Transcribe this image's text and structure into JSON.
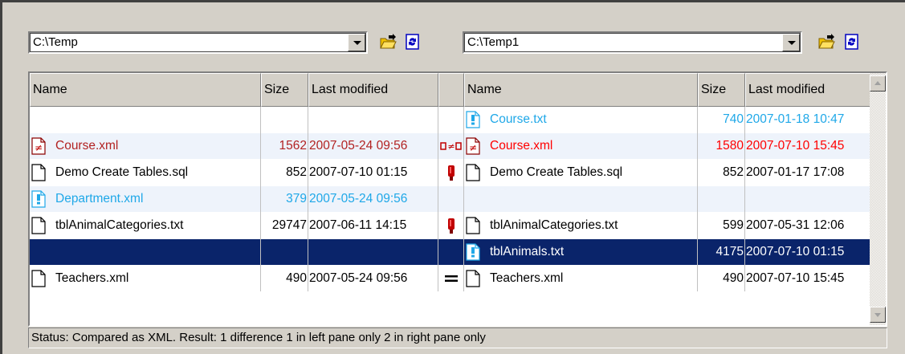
{
  "left_path": "C:\\Temp",
  "right_path": "C:\\Temp1",
  "columns": {
    "name": "Name",
    "size": "Size",
    "modified": "Last modified"
  },
  "colors": {
    "red": "#b22222",
    "brightred": "#ff0000",
    "blue": "#1fa8e8",
    "selected_bg": "#0a246a"
  },
  "rows": [
    {
      "left": null,
      "compare": null,
      "right": {
        "name": "Course.txt",
        "size": "740",
        "modified": "2007-01-18 10:47",
        "icon": "file-only-icon",
        "color": "blue"
      },
      "style": "plain"
    },
    {
      "left": {
        "name": "Course.xml",
        "size": "1562",
        "modified": "2007-05-24 09:56",
        "icon": "file-different-icon",
        "color": "darkred"
      },
      "compare": "not-equal-icon",
      "right": {
        "name": "Course.xml",
        "size": "1580",
        "modified": "2007-07-10 15:45",
        "icon": "file-different-icon",
        "color": "brightred"
      },
      "style": "alt"
    },
    {
      "left": {
        "name": "Demo Create Tables.sql",
        "size": "852",
        "modified": "2007-07-10 01:15",
        "icon": "file-icon",
        "color": "black"
      },
      "compare": "not-compared-icon",
      "right": {
        "name": "Demo Create Tables.sql",
        "size": "852",
        "modified": "2007-01-17 17:08",
        "icon": "file-icon",
        "color": "black"
      },
      "style": "plain"
    },
    {
      "left": {
        "name": "Department.xml",
        "size": "379",
        "modified": "2007-05-24 09:56",
        "icon": "file-only-icon",
        "color": "blue"
      },
      "compare": null,
      "right": null,
      "style": "alt"
    },
    {
      "left": {
        "name": "tblAnimalCategories.txt",
        "size": "29747",
        "modified": "2007-06-11 14:15",
        "icon": "file-icon",
        "color": "black"
      },
      "compare": "not-compared-icon",
      "right": {
        "name": "tblAnimalCategories.txt",
        "size": "599",
        "modified": "2007-05-31 12:06",
        "icon": "file-icon",
        "color": "black"
      },
      "style": "plain"
    },
    {
      "left": null,
      "compare": null,
      "right": {
        "name": "tblAnimals.txt",
        "size": "4175",
        "modified": "2007-07-10 01:15",
        "icon": "file-only-icon",
        "color": "white"
      },
      "style": "sel"
    },
    {
      "left": {
        "name": "Teachers.xml",
        "size": "490",
        "modified": "2007-05-24 09:56",
        "icon": "file-icon",
        "color": "black"
      },
      "compare": "equal-icon",
      "right": {
        "name": "Teachers.xml",
        "size": "490",
        "modified": "2007-07-10 15:45",
        "icon": "file-icon",
        "color": "black"
      },
      "style": "plain"
    }
  ],
  "status": "Status: Compared as XML. Result: 1 difference 1 in left pane only 2 in right pane only"
}
